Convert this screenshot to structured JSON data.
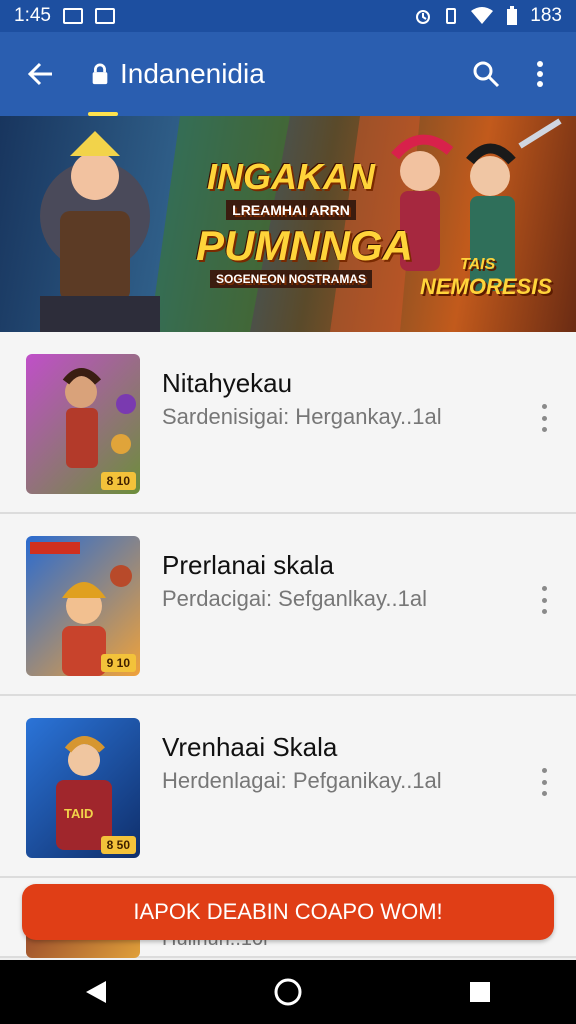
{
  "status_bar": {
    "time": "1:45",
    "battery": "183",
    "icons": [
      "image-icon",
      "gallery-icon",
      "alarm-icon",
      "vibrate-icon",
      "wifi-icon",
      "battery-icon"
    ]
  },
  "app_bar": {
    "title": "Indanenidia",
    "icons": [
      "back-arrow-icon",
      "lock-icon",
      "search-icon",
      "more-vert-icon"
    ]
  },
  "banner": {
    "line1": "INGAKAN",
    "line2": "LREAMHAI ARRN",
    "line3": "PUMNNGA",
    "line4": "SOGENEON NOSTRAMAS",
    "tag_top": "TAIS",
    "tag_bottom": "NEMORESIS"
  },
  "list": [
    {
      "title": "Nitahyekau",
      "subtitle": "Sardenisigai: Hergankay..1al",
      "badge": "8 10"
    },
    {
      "title": "Prerlanai skala",
      "subtitle": "Perdacigai: Sefganlkay..1al",
      "badge": "9 10"
    },
    {
      "title": "Vrenhaai Skala",
      "subtitle": "Herdenlagai: Pefganikay..1al",
      "badge": "8 50"
    }
  ],
  "partial_row": {
    "subtitle": "Hullrlun..10l"
  },
  "cta": {
    "label": "IAPOK DEABIN COAPO WOM!"
  },
  "nav_bar": {
    "icons": [
      "back-triangle-icon",
      "home-circle-icon",
      "recents-square-icon"
    ]
  },
  "colors": {
    "app_bar": "#2a5eb0",
    "status_bar": "#1d4fa0",
    "cta": "#e03e16",
    "accent": "#ffe24d"
  }
}
